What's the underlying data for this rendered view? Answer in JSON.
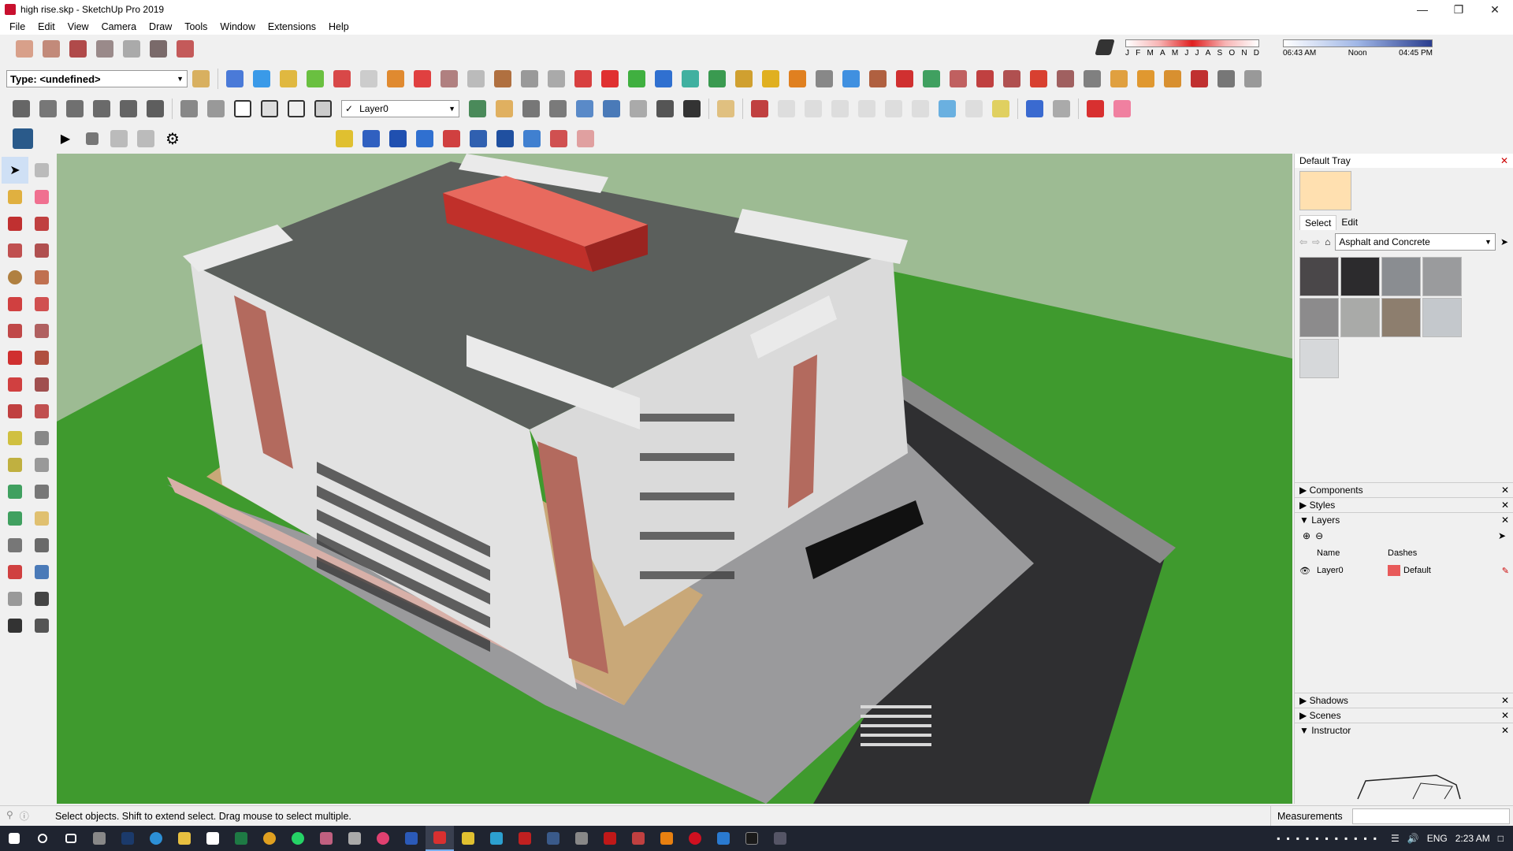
{
  "window": {
    "title": "high rise.skp - SketchUp Pro 2019"
  },
  "menu": [
    "File",
    "Edit",
    "View",
    "Camera",
    "Draw",
    "Tools",
    "Window",
    "Extensions",
    "Help"
  ],
  "toolbar": {
    "type_label": "Type: <undefined>",
    "layer_select": "Layer0"
  },
  "shadow": {
    "months": [
      "J",
      "F",
      "M",
      "A",
      "M",
      "J",
      "J",
      "A",
      "S",
      "O",
      "N",
      "D"
    ],
    "time_start": "06:43 AM",
    "time_mid": "Noon",
    "time_end": "04:45 PM"
  },
  "tray": {
    "title": "Default Tray",
    "tab_select": "Select",
    "tab_edit": "Edit",
    "material_collection": "Asphalt and Concrete",
    "materials": [
      "#4a4749",
      "#2c2b2d",
      "#8a8d91",
      "#9a9b9d",
      "#8c8b8c",
      "#a9aaa8",
      "#8d7e6e",
      "#c4c8cc",
      "#d6d8da"
    ],
    "panels": {
      "components": "Components",
      "styles": "Styles",
      "layers": "Layers",
      "shadows": "Shadows",
      "scenes": "Scenes",
      "instructor": "Instructor"
    },
    "layers_table": {
      "col_name": "Name",
      "col_dashes": "Dashes",
      "rows": [
        {
          "name": "Layer0",
          "dashes": "Default",
          "color": "#e85a5a"
        }
      ]
    }
  },
  "status": {
    "message": "Select objects. Shift to extend select. Drag mouse to select multiple.",
    "measurements_label": "Measurements"
  },
  "taskbar": {
    "lang": "ENG",
    "clock": "2:23 AM"
  },
  "colors": {
    "sky": "#9dbb93",
    "grass": "#3f9a2e",
    "roof": "#5b5f5c",
    "facade": "#e2e2e2",
    "accent_box": "#d23b3b",
    "road": "#2f2f31"
  }
}
